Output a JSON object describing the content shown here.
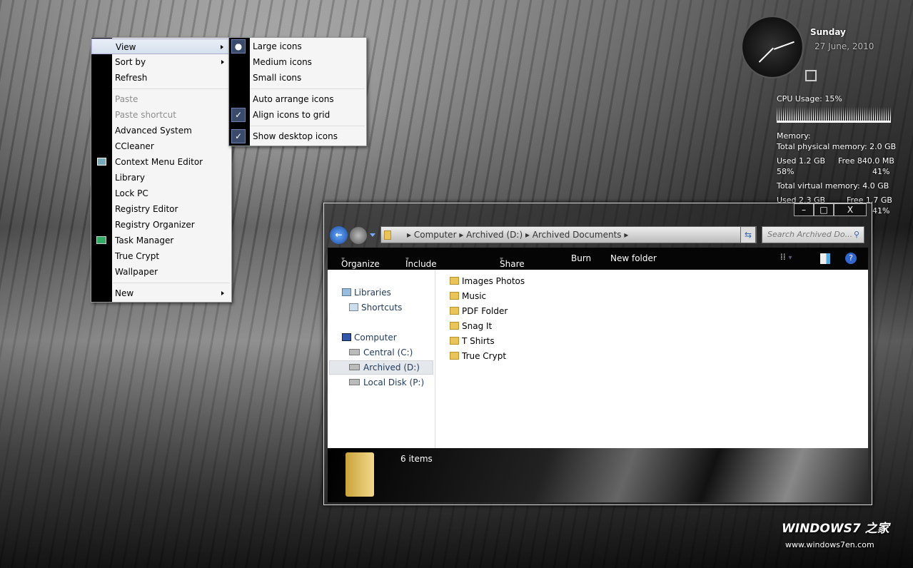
{
  "context_menu": {
    "items": [
      {
        "label": "View",
        "submenu": true,
        "highlighted": true
      },
      {
        "label": "Sort by",
        "submenu": true
      },
      {
        "label": "Refresh"
      },
      {
        "label": "Paste",
        "disabled": true
      },
      {
        "label": "Paste shortcut",
        "disabled": true
      },
      {
        "label": "Advanced System"
      },
      {
        "label": "CCleaner"
      },
      {
        "label": "Context Menu Editor"
      },
      {
        "label": "Library"
      },
      {
        "label": "Lock PC"
      },
      {
        "label": "Registry Editor"
      },
      {
        "label": "Registry Organizer"
      },
      {
        "label": "Task Manager"
      },
      {
        "label": "True Crypt"
      },
      {
        "label": "Wallpaper"
      },
      {
        "label": "New",
        "submenu": true
      }
    ]
  },
  "view_submenu": {
    "items": [
      {
        "label": "Large icons",
        "selected": true
      },
      {
        "label": "Medium icons"
      },
      {
        "label": "Small icons"
      },
      {
        "label": "Auto arrange icons"
      },
      {
        "label": "Align icons to grid",
        "checked": true
      },
      {
        "label": "Show desktop icons",
        "checked": true
      }
    ]
  },
  "gadgets": {
    "day": "Sunday",
    "date": "27 June, 2010",
    "cpu": "CPU Usage: 15%",
    "memory_title": "Memory:",
    "physical_total": "Total physical memory: 2.0 GB",
    "physical_used": "Used 1.2 GB",
    "physical_free": "Free 840.0 MB",
    "physical_used_pct": "58%",
    "physical_free_pct": "41%",
    "virtual_total": "Total virtual memory: 4.0 GB",
    "virtual_used": "Used 2.3 GB",
    "virtual_free": "Free 1.7 GB",
    "virtual_free_pct": "41%"
  },
  "explorer": {
    "breadcrumb": [
      "Computer",
      "Archived (D:)",
      "Archived Documents"
    ],
    "search_placeholder": "Search Archived Do...",
    "toolbar": {
      "organize": "Organize",
      "include": "Include in library",
      "share": "Share with",
      "burn": "Burn",
      "new_folder": "New folder"
    },
    "nav": {
      "libraries": "Libraries",
      "shortcuts": "Shortcuts",
      "computer": "Computer",
      "drives": [
        "Central (C:)",
        "Archived (D:)",
        "Local Disk (P:)"
      ],
      "selected_drive": "Archived (D:)"
    },
    "files": [
      "Images Photos",
      "Music",
      "PDF Folder",
      "Snag It",
      "T Shirts",
      "True Crypt"
    ],
    "status": "6 items"
  },
  "watermark": {
    "brand": "WINDOWS7 之家",
    "url": "www.windows7en.com"
  }
}
